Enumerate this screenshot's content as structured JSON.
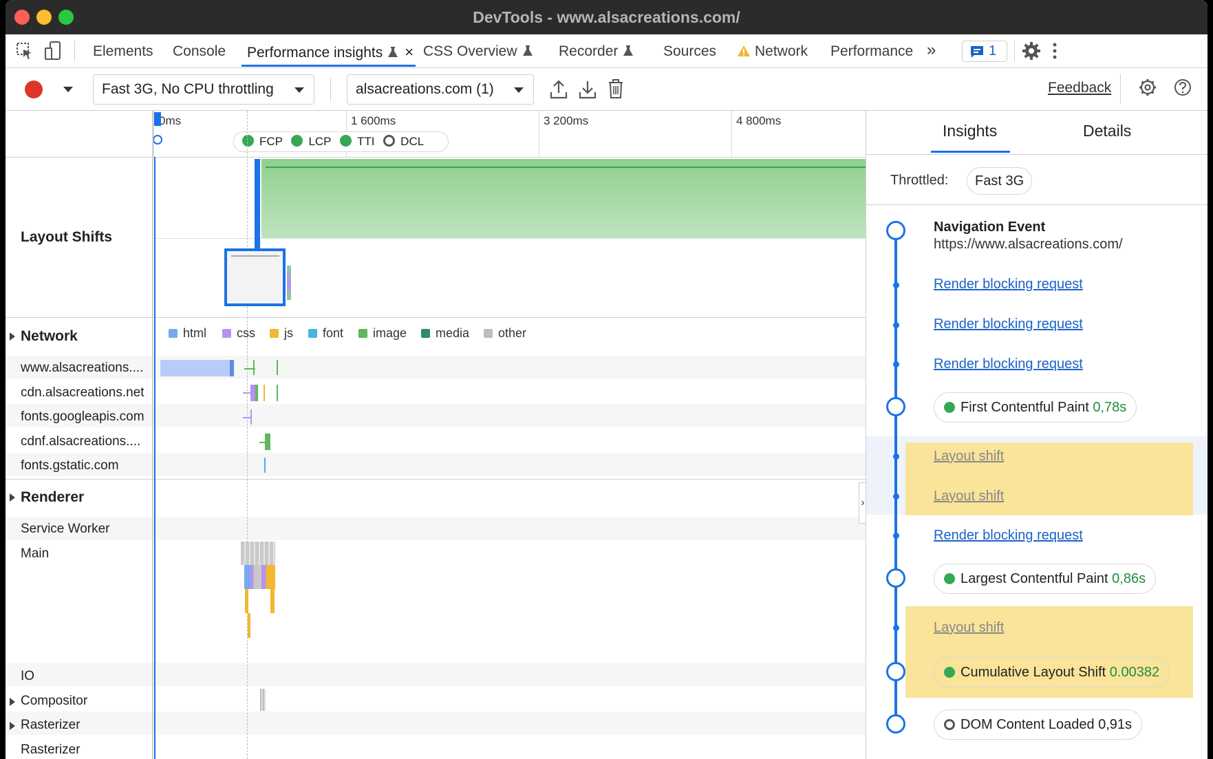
{
  "window": {
    "title": "DevTools - www.alsacreations.com/"
  },
  "tabs": [
    {
      "label": "Elements"
    },
    {
      "label": "Console"
    },
    {
      "label": "Performance insights"
    },
    {
      "label": "CSS Overview"
    },
    {
      "label": "Recorder"
    },
    {
      "label": "Sources"
    },
    {
      "label": "Network"
    },
    {
      "label": "Performance"
    }
  ],
  "tabbar": {
    "overflow": "»",
    "issues_count": "1",
    "close": "×"
  },
  "toolbar": {
    "throttling": "Fast 3G, No CPU throttling",
    "recording": "alsacreations.com (1)",
    "feedback": "Feedback"
  },
  "ruler": {
    "labels": [
      "0ms",
      "1 600ms",
      "3 200ms",
      "4 800ms"
    ],
    "markers": [
      "FCP",
      "LCP",
      "TTI",
      "DCL"
    ]
  },
  "tracks": {
    "layout_shifts": "Layout Shifts",
    "network": "Network",
    "hosts": [
      "www.alsacreations....",
      "cdn.alsacreations.net",
      "fonts.googleapis.com",
      "cdnf.alsacreations....",
      "fonts.gstatic.com"
    ],
    "renderer": "Renderer",
    "service_worker": "Service Worker",
    "main": "Main",
    "io": "IO",
    "compositor": "Compositor",
    "rasterizer1": "Rasterizer",
    "rasterizer2": "Rasterizer"
  },
  "legend": [
    "html",
    "css",
    "js",
    "font",
    "image",
    "media",
    "other"
  ],
  "colors": {
    "html": "#7ba7f0",
    "css": "#b892f0",
    "js": "#f2b733",
    "font": "#48b4e0",
    "image": "#5cb85c",
    "media": "#2e8b6a",
    "other": "#bdbdbd",
    "accent": "#1a73e8",
    "highlight": "#f9e49a"
  },
  "side": {
    "tab_insights": "Insights",
    "tab_details": "Details",
    "throttled_label": "Throttled:",
    "throttled_value": "Fast 3G",
    "nav_title": "Navigation Event",
    "nav_url": "https://www.alsacreations.com/",
    "rbr": "Render blocking request",
    "layout_shift": "Layout shift",
    "fcp_label": "First Contentful Paint",
    "fcp_value": "0,78s",
    "lcp_label": "Largest Contentful Paint",
    "lcp_value": "0,86s",
    "cls_label": "Cumulative Layout Shift",
    "cls_value": "0.00382",
    "dcl_label": "DOM Content Loaded",
    "dcl_value": "0,91s"
  }
}
